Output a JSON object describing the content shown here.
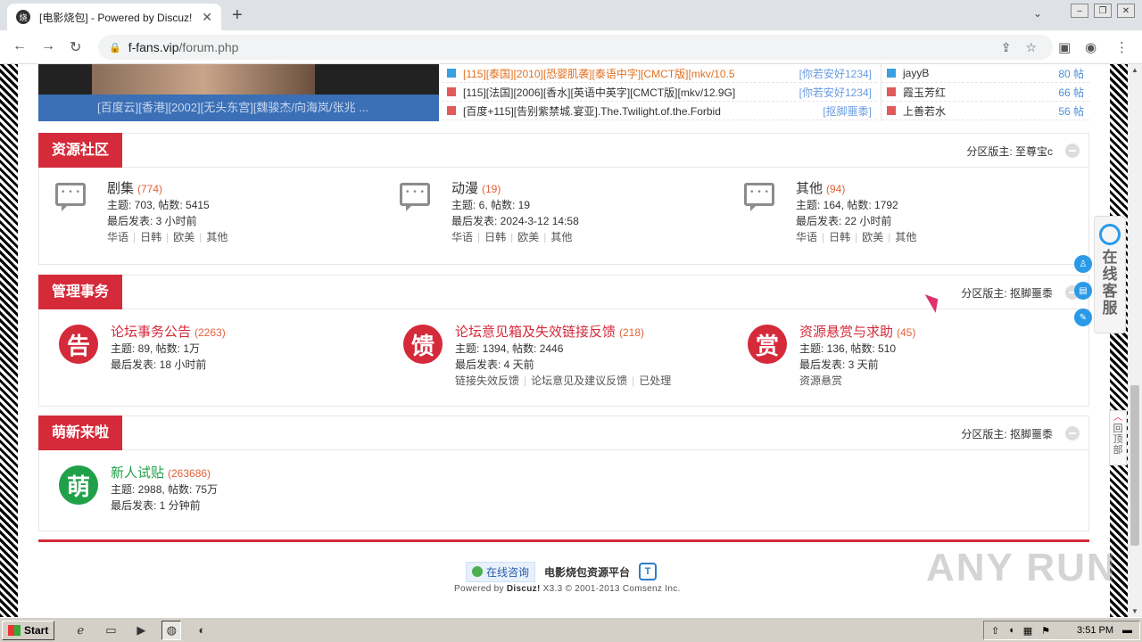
{
  "browser": {
    "tab_title": "[电影烧包] - Powered by Discuz!",
    "tab_favicon": "烧",
    "url_host": "f-fans.vip",
    "url_path": "/forum.php"
  },
  "top": {
    "slide_caption": "[百度云][香港][2002][无头东宫][魏骏杰/向海岚/张兆 ...",
    "threads": [
      {
        "title": "[115][泰国][2010][恐婴肌袭][泰语中字][CMCT版][mkv/10.5",
        "user": "[你若安好1234]",
        "icon": "blue"
      },
      {
        "title": "[115][法国][2006][香水][英语中英字][CMCT版][mkv/12.9G]",
        "user": "[你若安好1234]",
        "icon": "red"
      },
      {
        "title": "[百度+115][告别紫禁城.宴亚].The.Twilight.of.the.Forbid",
        "user": "[抠脚噩黍]",
        "icon": "red"
      }
    ],
    "ranking": [
      {
        "name": "jayyB",
        "count": "80 帖",
        "icon": "blue"
      },
      {
        "name": "霞玉芳红",
        "count": "66 帖",
        "icon": "red"
      },
      {
        "name": "上善若水",
        "count": "56 帖",
        "icon": "red"
      }
    ]
  },
  "categories": [
    {
      "title": "资源社区",
      "moderator": "分区版主: 至尊宝c",
      "forums": [
        {
          "name": "剧集",
          "count": "(774)",
          "stat": "主题: 703, 帖数: 5415",
          "last": "最后发表: 3 小时前",
          "subs": [
            "华语",
            "日韩",
            "欧美",
            "其他"
          ]
        },
        {
          "name": "动漫",
          "count": "(19)",
          "stat": "主题: 6, 帖数: 19",
          "last": "最后发表: 2024-3-12 14:58",
          "subs": [
            "华语",
            "日韩",
            "欧美",
            "其他"
          ]
        },
        {
          "name": "其他",
          "count": "(94)",
          "stat": "主题: 164, 帖数: 1792",
          "last": "最后发表: 22 小时前",
          "subs": [
            "华语",
            "日韩",
            "欧美",
            "其他"
          ]
        }
      ]
    },
    {
      "title": "管理事务",
      "moderator": "分区版主: 抠脚噩黍",
      "forums": [
        {
          "icon_char": "告",
          "name": "论坛事务公告",
          "count": "(2263)",
          "stat": "主题: 89, 帖数: 1万",
          "last": "最后发表: 18 小时前",
          "subs": []
        },
        {
          "icon_char": "馈",
          "name": "论坛意见箱及失效链接反馈",
          "count": "(218)",
          "stat": "主题: 1394, 帖数: 2446",
          "last": "最后发表: 4 天前",
          "subs": [
            "链接失效反馈",
            "论坛意见及建议反馈",
            "已处理"
          ]
        },
        {
          "icon_char": "赏",
          "name": "资源悬赏与求助",
          "count": "(45)",
          "stat": "主题: 136, 帖数: 510",
          "last": "最后发表: 3 天前",
          "subs": [
            "资源悬赏"
          ]
        }
      ]
    },
    {
      "title": "萌新来啦",
      "moderator": "分区版主: 抠脚噩黍",
      "forums": [
        {
          "icon_char": "萌",
          "name": "新人试贴",
          "count": "(263686)",
          "stat": "主题: 2988, 帖数: 75万",
          "last": "最后发表: 1 分钟前",
          "subs": []
        }
      ]
    }
  ],
  "footer": {
    "consult": "在线咨询",
    "platform": "电影烧包资源平台",
    "powered_prefix": "Powered by",
    "powered_name": "Discuz!",
    "powered_rest": "X3.3 © 2001-2013 Comsenz Inc."
  },
  "widgets": {
    "service_text": "在线客服",
    "back_to_top": "回顶部",
    "watermark": "ANY RUN"
  },
  "taskbar": {
    "start": "Start",
    "clock": "3:51 PM"
  },
  "colors": {
    "brand_red": "#d42a3a",
    "link_blue": "#4a90d9",
    "newbie_green": "#21a04a"
  }
}
